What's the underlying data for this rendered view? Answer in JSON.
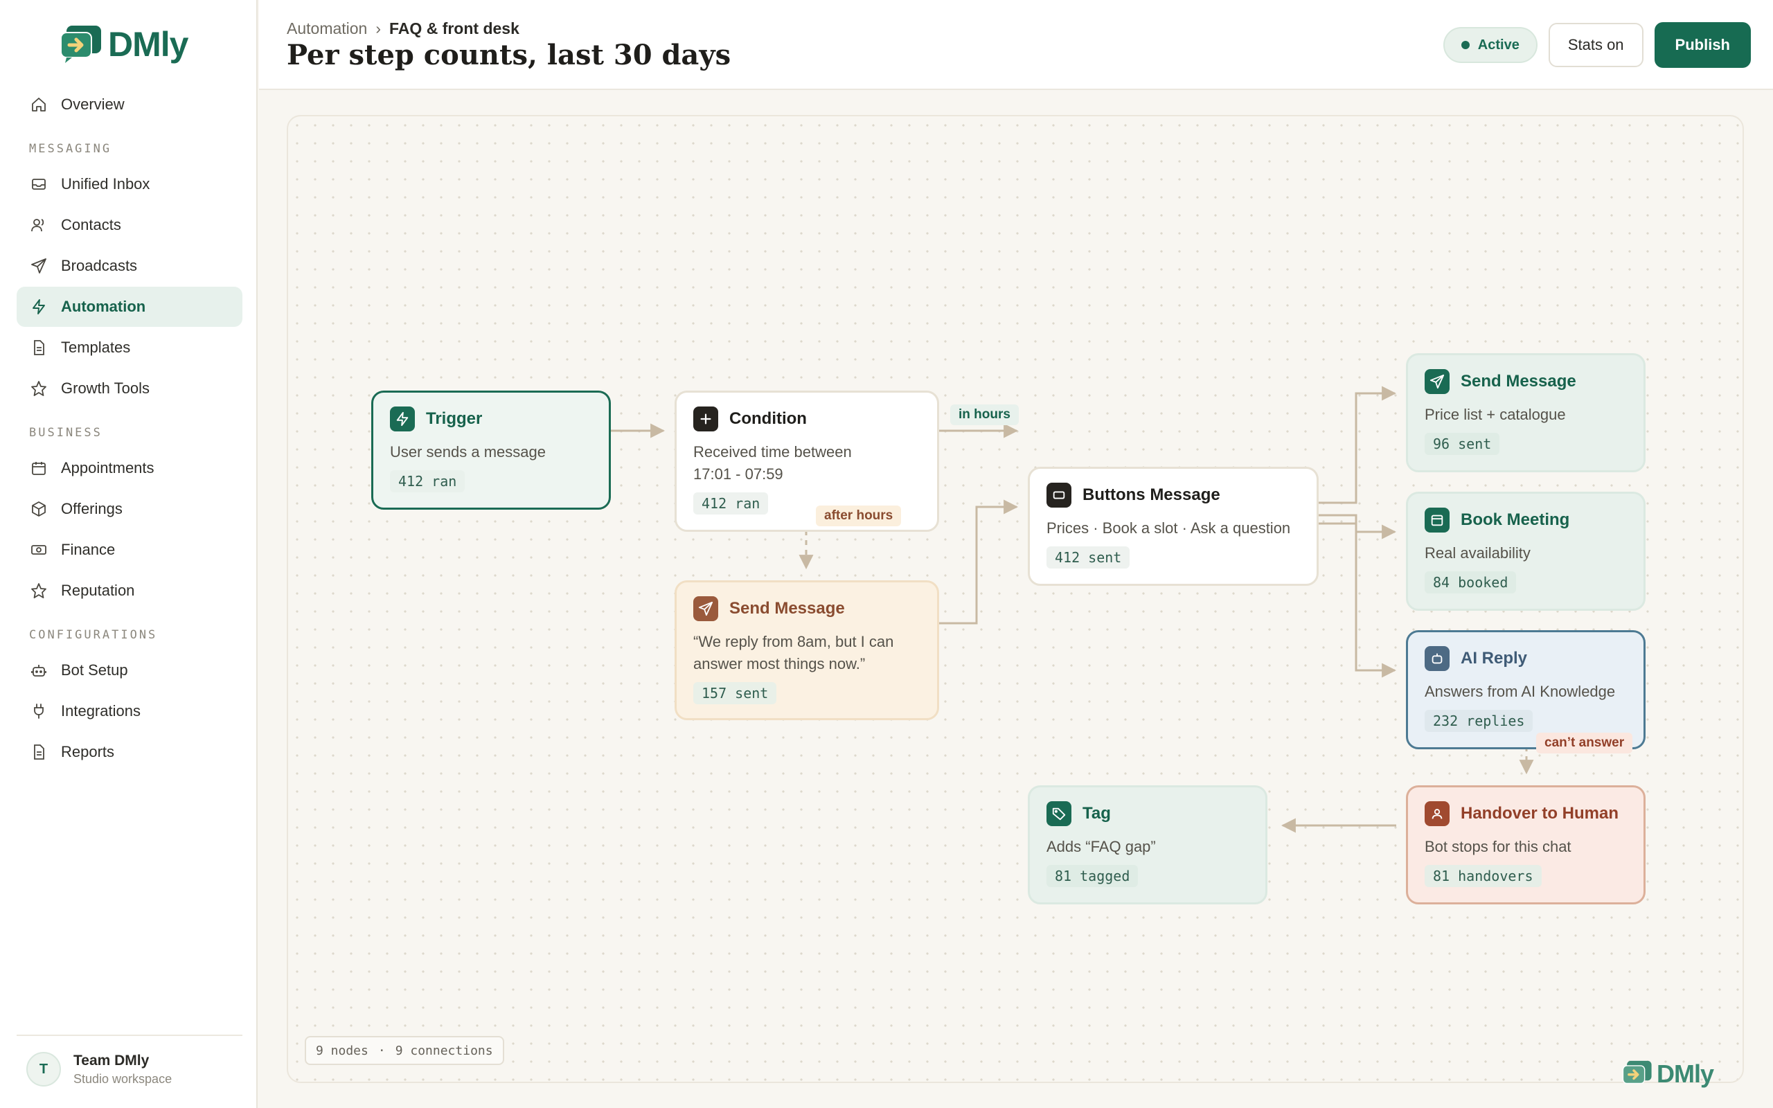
{
  "brand": {
    "name": "DMly",
    "color": "#1a6b54"
  },
  "sidebar": {
    "items": [
      {
        "label": "Overview",
        "icon": "home-icon"
      },
      {
        "section": "MESSAGING"
      },
      {
        "label": "Unified Inbox",
        "icon": "inbox-icon"
      },
      {
        "label": "Contacts",
        "icon": "users-icon"
      },
      {
        "label": "Broadcasts",
        "icon": "send-icon"
      },
      {
        "label": "Automation",
        "icon": "bolt-icon",
        "active": true
      },
      {
        "label": "Templates",
        "icon": "document-icon"
      },
      {
        "label": "Growth Tools",
        "icon": "star-icon"
      },
      {
        "section": "BUSINESS"
      },
      {
        "label": "Appointments",
        "icon": "calendar-icon"
      },
      {
        "label": "Offerings",
        "icon": "box-icon"
      },
      {
        "label": "Finance",
        "icon": "cash-icon"
      },
      {
        "label": "Reputation",
        "icon": "star-icon"
      },
      {
        "section": "CONFIGURATIONS"
      },
      {
        "label": "Bot Setup",
        "icon": "bot-icon"
      },
      {
        "label": "Integrations",
        "icon": "plug-icon"
      },
      {
        "label": "Reports",
        "icon": "document-icon"
      }
    ],
    "team": {
      "initial": "T",
      "name": "Team DMly",
      "subtitle": "Studio workspace"
    }
  },
  "header": {
    "breadcrumb": {
      "parent": "Automation",
      "separator": "›",
      "current": "FAQ & front desk"
    },
    "title": "Per step counts, last 30 days",
    "status": "Active",
    "stats_toggle": "Stats on",
    "publish": "Publish"
  },
  "flow": {
    "nodes": {
      "trigger": {
        "title": "Trigger",
        "desc": "User sends a message",
        "stat": "412 ran",
        "icon": "bolt-icon"
      },
      "condition": {
        "title": "Condition",
        "desc": "Received time between 17:01 - 07:59",
        "stat": "412 ran",
        "icon": "plus-icon"
      },
      "send_after": {
        "title": "Send Message",
        "desc": "“We reply from 8am, but I can answer most things now.”",
        "stat": "157 sent",
        "icon": "send-icon"
      },
      "buttons": {
        "title": "Buttons Message",
        "desc": "Prices · Book a slot · Ask a question",
        "stat": "412 sent",
        "icon": "button-icon"
      },
      "send_price": {
        "title": "Send Message",
        "desc": "Price list + catalogue",
        "stat": "96 sent",
        "icon": "send-icon"
      },
      "book": {
        "title": "Book Meeting",
        "desc": "Real availability",
        "stat": "84 booked",
        "icon": "calendar-icon"
      },
      "ai": {
        "title": "AI Reply",
        "desc": "Answers from AI Knowledge",
        "stat": "232 replies",
        "icon": "bot-icon"
      },
      "handover": {
        "title": "Handover to Human",
        "desc": "Bot stops for this chat",
        "stat": "81 handovers",
        "icon": "person-icon"
      },
      "tag": {
        "title": "Tag",
        "desc": "Adds “FAQ gap”",
        "stat": "81 tagged",
        "icon": "tag-icon"
      }
    },
    "edge_labels": {
      "in_hours": "in hours",
      "after_hours": "after hours",
      "cant_answer": "can’t answer"
    },
    "summary": {
      "nodes": "9 nodes",
      "separator": "·",
      "connections": "9 connections"
    }
  },
  "colors": {
    "accent": "#1a6b54",
    "edge": "#c8b9a3",
    "canvas": "#f8f6f1"
  }
}
